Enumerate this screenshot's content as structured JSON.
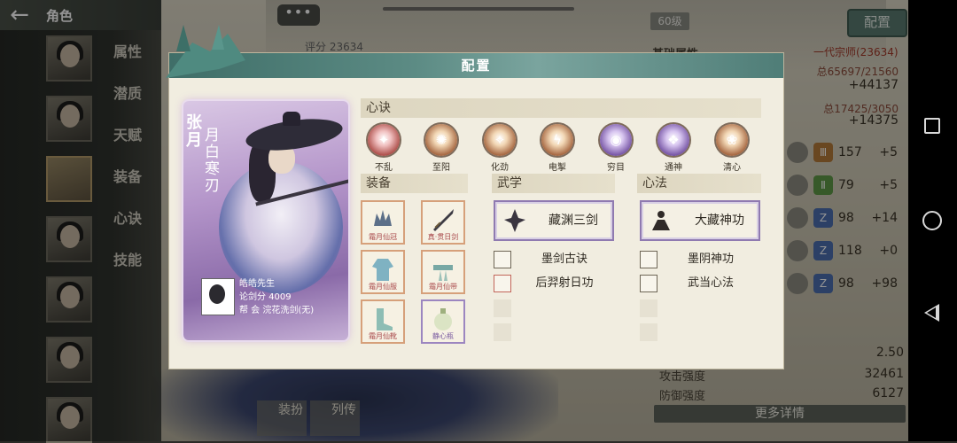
{
  "sidebar": {
    "title": "角色",
    "menu": [
      "属性",
      "潜质",
      "天赋",
      "装备",
      "心诀",
      "技能"
    ]
  },
  "chat": {
    "label": "•••"
  },
  "right_panel": {
    "level": "60级",
    "config_button": "配置",
    "score_label": "评分",
    "score_value": "23634",
    "base_attr_label": "基础属性",
    "rank": "一代宗师(23634)",
    "total1": "总65697/21560",
    "plus1": "+44137",
    "total2": "总17425/3050",
    "plus2": "+14375",
    "stats": [
      {
        "icon": "sword-stat-icon",
        "badge": "Ⅲ",
        "value": "157",
        "plus": "+5"
      },
      {
        "icon": "staff-stat-icon",
        "badge": "Ⅱ",
        "value": "79",
        "plus": "+5"
      },
      {
        "icon": "fist-stat-icon",
        "badge": "Z",
        "value": "98",
        "plus": "+14"
      },
      {
        "icon": "spear-stat-icon",
        "badge": "Z",
        "value": "118",
        "plus": "+0"
      },
      {
        "icon": "hidden-weapon-stat-icon",
        "badge": "Z",
        "value": "98",
        "plus": "+98"
      }
    ],
    "val_a": "2.50",
    "attack_label": "攻击强度",
    "attack_value": "32461",
    "defense_label": "防御强度",
    "defense_value": "6127",
    "more_button": "更多详情"
  },
  "bottom_tabs": [
    "装扮",
    "列传"
  ],
  "dialog": {
    "title": "配置",
    "character": {
      "name": "张月",
      "title": "月白寒刃",
      "player_name": "皓皓先生",
      "sword_score": "论剑分 4009",
      "guild": "帮  会 浣花洗剑(无)"
    },
    "xinjue": {
      "header": "心诀",
      "skills": [
        {
          "label": "不乱",
          "color": "r",
          "glyph": "✦"
        },
        {
          "label": "至阳",
          "color": "o",
          "glyph": "✺"
        },
        {
          "label": "化劲",
          "color": "o",
          "glyph": "✧"
        },
        {
          "label": "电掣",
          "color": "o",
          "glyph": "ϟ"
        },
        {
          "label": "穷目",
          "color": "p",
          "glyph": "◉"
        },
        {
          "label": "通神",
          "color": "p",
          "glyph": "❖"
        },
        {
          "label": "清心",
          "color": "o",
          "glyph": "❀"
        }
      ]
    },
    "equipment": {
      "header": "装备",
      "items": [
        {
          "label": "霜月仙冠",
          "frame": "orange"
        },
        {
          "label": "真·贯日剑",
          "frame": "orange"
        },
        {
          "label": "霜月仙服",
          "frame": "orange"
        },
        {
          "label": "霜月仙带",
          "frame": "orange"
        },
        {
          "label": "霜月仙靴",
          "frame": "orange"
        },
        {
          "label": "静心瓶",
          "frame": "purple"
        }
      ]
    },
    "wuxue": {
      "header": "武学",
      "main": "藏渊三剑",
      "list": [
        {
          "label": "墨剑古诀",
          "frame": "dark"
        },
        {
          "label": "后羿射日功",
          "frame": "red"
        }
      ]
    },
    "xinfa": {
      "header": "心法",
      "main": "大藏神功",
      "list": [
        {
          "label": "墨阴神功",
          "frame": "dark"
        },
        {
          "label": "武当心法",
          "frame": "dark"
        }
      ]
    }
  }
}
